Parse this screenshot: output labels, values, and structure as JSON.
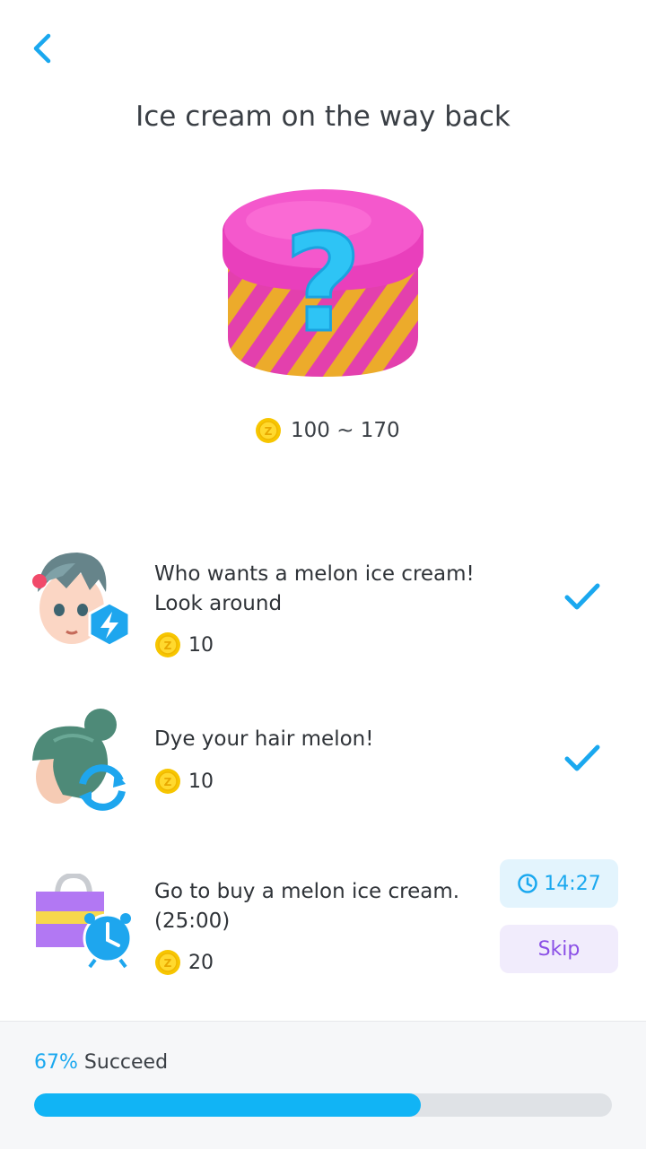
{
  "header": {
    "title": "Ice cream on the way back",
    "back_icon": "chevron-left-icon"
  },
  "reward": {
    "range": "100 ~ 170",
    "icon": "coin-icon"
  },
  "tasks": [
    {
      "title": "Who wants a melon ice cream!\nLook around",
      "reward": "10",
      "icon": "avatar-boost-icon",
      "status": "done"
    },
    {
      "title": "Dye your hair melon!",
      "reward": "10",
      "icon": "hair-dye-icon",
      "status": "done"
    },
    {
      "title": "Go to buy a melon ice cream.\n(25:00)",
      "reward": "20",
      "icon": "shopping-timer-icon",
      "status": "in-progress",
      "timer": "14:27",
      "skip_label": "Skip"
    }
  ],
  "progress": {
    "percent_label": "67%",
    "label": "Succeed",
    "value": 0.67
  },
  "colors": {
    "accent": "#11b4f5",
    "skip_text": "#8a4fe6",
    "box_pink": "#f23fc0",
    "box_yellow": "#fbb62e"
  }
}
